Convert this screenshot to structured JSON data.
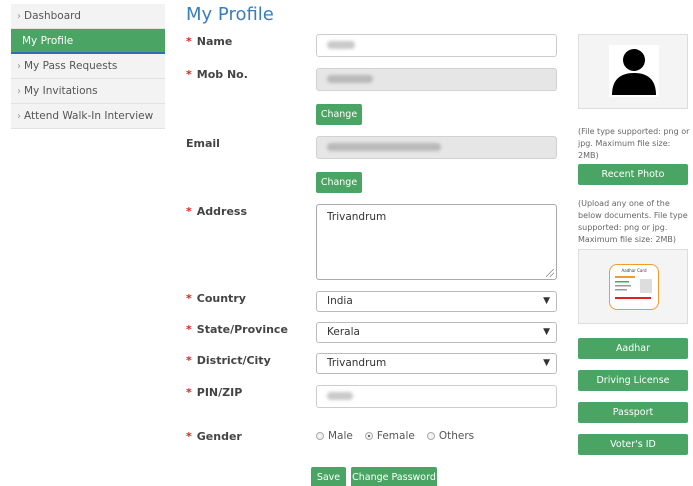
{
  "sidebar": {
    "items": [
      {
        "label": "Dashboard"
      },
      {
        "label": "My Profile"
      },
      {
        "label": "My Pass Requests"
      },
      {
        "label": "My Invitations"
      },
      {
        "label": "Attend Walk-In Interview"
      }
    ]
  },
  "page_title": "My Profile",
  "form": {
    "name": {
      "label": "Name"
    },
    "mobile": {
      "label": "Mob No.",
      "change_label": "Change"
    },
    "email": {
      "label": "Email",
      "change_label": "Change"
    },
    "address": {
      "label": "Address",
      "value": "Trivandrum"
    },
    "country": {
      "label": "Country",
      "value": "India"
    },
    "state": {
      "label": "State/Province",
      "value": "Kerala"
    },
    "district": {
      "label": "District/City",
      "value": "Trivandrum"
    },
    "pin": {
      "label": "PIN/ZIP"
    },
    "gender": {
      "label": "Gender",
      "options": [
        "Male",
        "Female",
        "Others"
      ],
      "selected": "Female"
    },
    "save_label": "Save",
    "change_password_label": "Change Password"
  },
  "photo": {
    "note": "(File type supported: png or jpg. Maximum file size: 2MB)",
    "button_label": "Recent Photo"
  },
  "documents": {
    "note": "(Upload any one of the below documents. File type supported: png or jpg. Maximum file size: 2MB)",
    "card_caption": "Aadhar Card",
    "buttons": [
      "Aadhar",
      "Driving License",
      "Passport",
      "Voter's ID"
    ]
  },
  "colors": {
    "accent_green": "#4aa564",
    "title_blue": "#3a7dbf",
    "required_red": "#dd2222"
  }
}
